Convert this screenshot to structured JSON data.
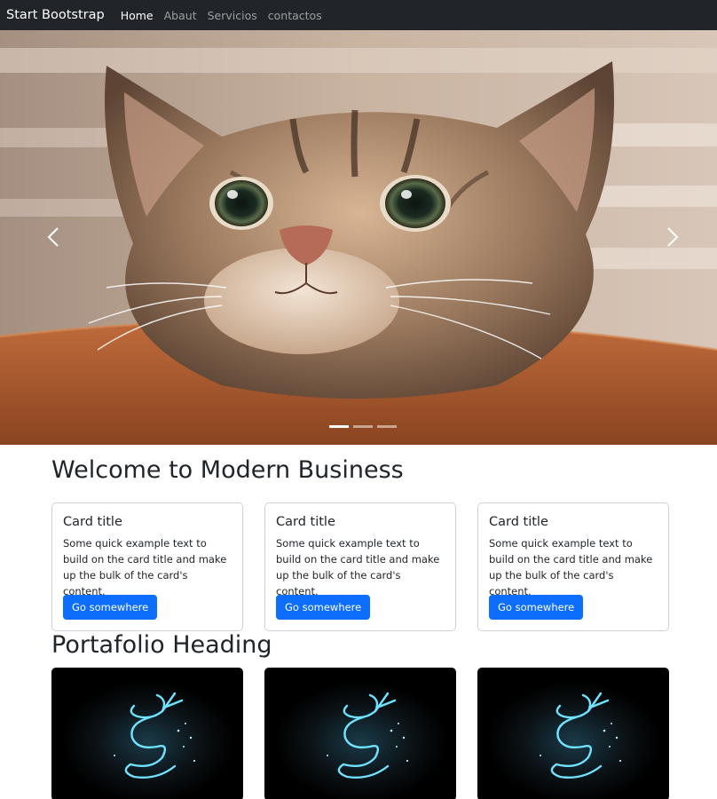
{
  "navbar": {
    "brand": "Start Bootstrap",
    "links": [
      {
        "label": "Home",
        "active": true
      },
      {
        "label": "Abaut",
        "active": false
      },
      {
        "label": "Servicios",
        "active": false
      },
      {
        "label": "contactos",
        "active": false
      }
    ]
  },
  "carousel": {
    "prev_icon": "chevron-left-icon",
    "next_icon": "chevron-right-icon",
    "slide_count": 3,
    "active_slide": 1
  },
  "welcome": {
    "heading": "Welcome to Modern Business"
  },
  "cards": [
    {
      "title": "Card title",
      "text": "Some quick example text to build on the card title and make up the bulk of the card's content.",
      "button": "Go somewhere"
    },
    {
      "title": "Card title",
      "text": "Some quick example text to build on the card title and make up the bulk of the card's content.",
      "button": "Go somewhere"
    },
    {
      "title": "Card title",
      "text": "Some quick example text to build on the card title and make up the bulk of the card's content.",
      "button": "Go somewhere"
    }
  ],
  "portfolio": {
    "heading": "Portafolio Heading"
  },
  "colors": {
    "navbar_bg": "#212529",
    "primary": "#0d6efd"
  }
}
